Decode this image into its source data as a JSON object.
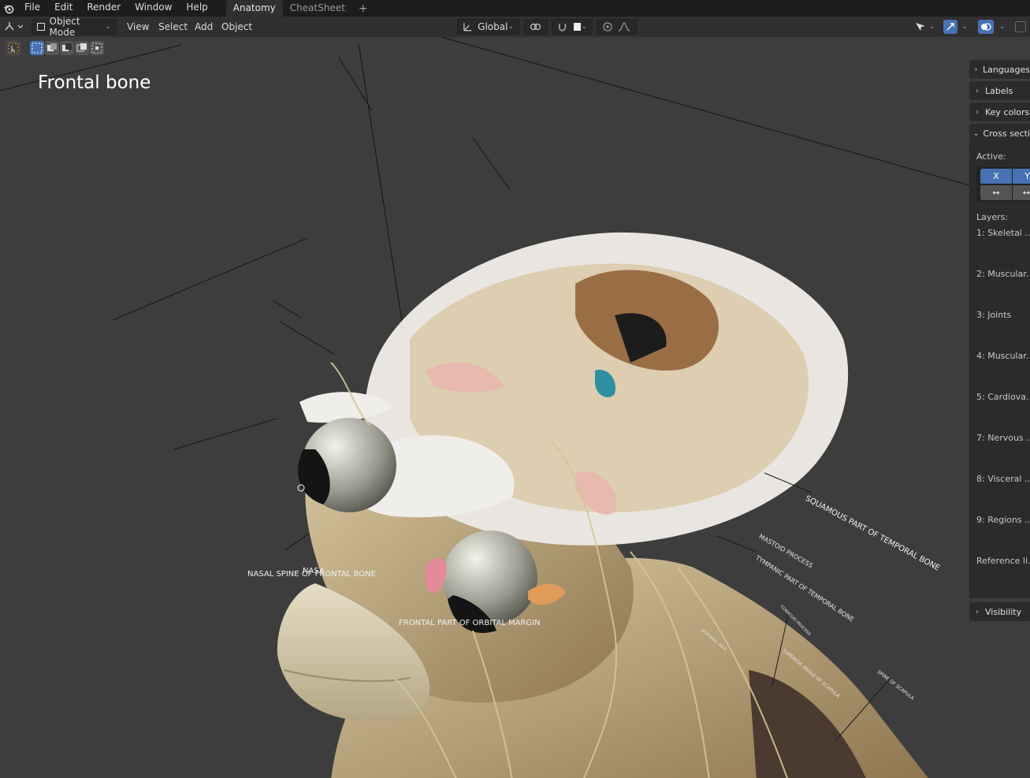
{
  "menubar": {
    "items": [
      "File",
      "Edit",
      "Render",
      "Window",
      "Help"
    ],
    "tabs": [
      {
        "label": "Anatomy",
        "active": true
      },
      {
        "label": "CheatSheet",
        "active": false
      }
    ],
    "add_tab": "+"
  },
  "header": {
    "mode": "Object Mode",
    "menus": [
      "View",
      "Select",
      "Add",
      "Object"
    ],
    "transform_orientation": "Global"
  },
  "viewport": {
    "object_name": "Frontal bone",
    "labels": [
      {
        "text": "NASAL SPINE OF FRONTAL BONE"
      },
      {
        "text": "FRONTAL PART OF ORBITAL MARGIN"
      },
      {
        "text": "SQUAMOUS PART OF TEMPORAL BONE"
      },
      {
        "text": "MASTOID PROCESS"
      },
      {
        "text": "TYMPANIC PART OF TEMPORAL BONE"
      },
      {
        "text": "NASA"
      },
      {
        "text": "NTAL BONE"
      },
      {
        "text": "SPINE OF SCAPULA"
      },
      {
        "text": "SUPERIOR ANGLE OF SCAPULA"
      },
      {
        "text": "ACROMIAL FACE"
      },
      {
        "text": "CORACOID PROCESS"
      }
    ]
  },
  "npanel": {
    "sections": [
      {
        "label": "Languages",
        "expanded": false
      },
      {
        "label": "Labels",
        "expanded": false
      },
      {
        "label": "Key colors",
        "expanded": false
      },
      {
        "label": "Cross secti",
        "expanded": true
      }
    ],
    "active_label": "Active:",
    "axis_buttons": [
      "X",
      "Y"
    ],
    "flip_buttons": [
      "↔",
      "↔"
    ],
    "layers_label": "Layers:",
    "layers": [
      "1: Skeletal ...",
      "2: Muscular...",
      "3: Joints",
      "4: Muscular...",
      "5: Cardiova...",
      "7: Nervous ...",
      "8: Visceral ...",
      "9: Regions ...",
      "Reference li..."
    ],
    "visibility": "Visibility"
  },
  "colors": {
    "accent": "#4772b3",
    "bone": "#c8b48a",
    "skull_white": "#e9e6e2",
    "background": "#3d3d3d"
  }
}
